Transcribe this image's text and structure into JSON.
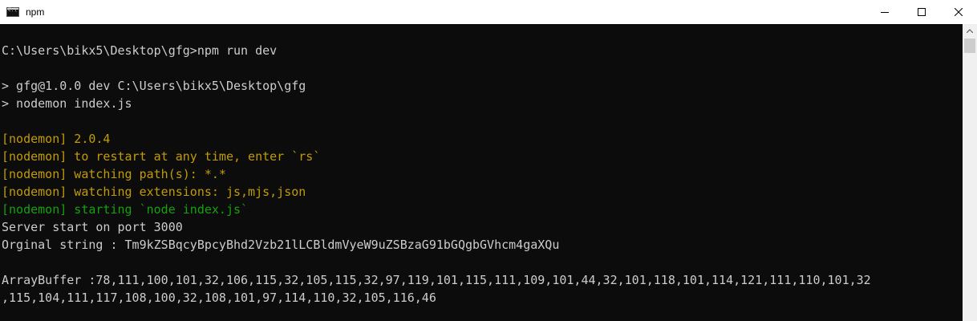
{
  "window": {
    "title": "npm",
    "icon": "cmd-icon",
    "controls": [
      "minimize-icon",
      "maximize-icon",
      "close-icon"
    ]
  },
  "console": {
    "lines": [
      {
        "text": "",
        "color": "default"
      },
      {
        "text": "C:\\Users\\bikx5\\Desktop\\gfg>npm run dev",
        "color": "default"
      },
      {
        "text": "",
        "color": "default"
      },
      {
        "text": "> gfg@1.0.0 dev C:\\Users\\bikx5\\Desktop\\gfg",
        "color": "default"
      },
      {
        "text": "> nodemon index.js",
        "color": "default"
      },
      {
        "text": "",
        "color": "default"
      },
      {
        "text": "[nodemon] 2.0.4",
        "color": "yellow"
      },
      {
        "text": "[nodemon] to restart at any time, enter `rs`",
        "color": "yellow"
      },
      {
        "text": "[nodemon] watching path(s): *.*",
        "color": "yellow"
      },
      {
        "text": "[nodemon] watching extensions: js,mjs,json",
        "color": "yellow"
      },
      {
        "text": "[nodemon] starting `node index.js`",
        "color": "green"
      },
      {
        "text": "Server start on port 3000",
        "color": "default"
      },
      {
        "text": "Orginal string : Tm9kZSBqcyBpcyBhd2Vzb21lLCBldmVyeW9uZSBzaG91bGQgbGVhcm4gaXQu",
        "color": "default"
      },
      {
        "text": "",
        "color": "default"
      },
      {
        "text": "ArrayBuffer :78,111,100,101,32,106,115,32,105,115,32,97,119,101,115,111,109,101,44,32,101,118,101,114,121,111,110,101,32",
        "color": "default"
      },
      {
        "text": ",115,104,111,117,108,100,32,108,101,97,114,110,32,105,116,46",
        "color": "default"
      }
    ]
  },
  "colors": {
    "background": "#0c0c0c",
    "default": "#cccccc",
    "yellow": "#c19c00",
    "green": "#13a10e"
  }
}
